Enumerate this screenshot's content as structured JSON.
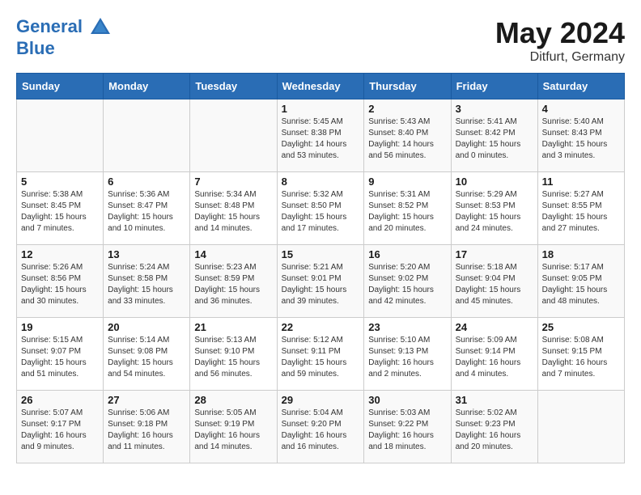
{
  "header": {
    "logo_line1": "General",
    "logo_line2": "Blue",
    "month": "May 2024",
    "location": "Ditfurt, Germany"
  },
  "weekdays": [
    "Sunday",
    "Monday",
    "Tuesday",
    "Wednesday",
    "Thursday",
    "Friday",
    "Saturday"
  ],
  "weeks": [
    [
      {
        "day": "",
        "info": ""
      },
      {
        "day": "",
        "info": ""
      },
      {
        "day": "",
        "info": ""
      },
      {
        "day": "1",
        "info": "Sunrise: 5:45 AM\nSunset: 8:38 PM\nDaylight: 14 hours\nand 53 minutes."
      },
      {
        "day": "2",
        "info": "Sunrise: 5:43 AM\nSunset: 8:40 PM\nDaylight: 14 hours\nand 56 minutes."
      },
      {
        "day": "3",
        "info": "Sunrise: 5:41 AM\nSunset: 8:42 PM\nDaylight: 15 hours\nand 0 minutes."
      },
      {
        "day": "4",
        "info": "Sunrise: 5:40 AM\nSunset: 8:43 PM\nDaylight: 15 hours\nand 3 minutes."
      }
    ],
    [
      {
        "day": "5",
        "info": "Sunrise: 5:38 AM\nSunset: 8:45 PM\nDaylight: 15 hours\nand 7 minutes."
      },
      {
        "day": "6",
        "info": "Sunrise: 5:36 AM\nSunset: 8:47 PM\nDaylight: 15 hours\nand 10 minutes."
      },
      {
        "day": "7",
        "info": "Sunrise: 5:34 AM\nSunset: 8:48 PM\nDaylight: 15 hours\nand 14 minutes."
      },
      {
        "day": "8",
        "info": "Sunrise: 5:32 AM\nSunset: 8:50 PM\nDaylight: 15 hours\nand 17 minutes."
      },
      {
        "day": "9",
        "info": "Sunrise: 5:31 AM\nSunset: 8:52 PM\nDaylight: 15 hours\nand 20 minutes."
      },
      {
        "day": "10",
        "info": "Sunrise: 5:29 AM\nSunset: 8:53 PM\nDaylight: 15 hours\nand 24 minutes."
      },
      {
        "day": "11",
        "info": "Sunrise: 5:27 AM\nSunset: 8:55 PM\nDaylight: 15 hours\nand 27 minutes."
      }
    ],
    [
      {
        "day": "12",
        "info": "Sunrise: 5:26 AM\nSunset: 8:56 PM\nDaylight: 15 hours\nand 30 minutes."
      },
      {
        "day": "13",
        "info": "Sunrise: 5:24 AM\nSunset: 8:58 PM\nDaylight: 15 hours\nand 33 minutes."
      },
      {
        "day": "14",
        "info": "Sunrise: 5:23 AM\nSunset: 8:59 PM\nDaylight: 15 hours\nand 36 minutes."
      },
      {
        "day": "15",
        "info": "Sunrise: 5:21 AM\nSunset: 9:01 PM\nDaylight: 15 hours\nand 39 minutes."
      },
      {
        "day": "16",
        "info": "Sunrise: 5:20 AM\nSunset: 9:02 PM\nDaylight: 15 hours\nand 42 minutes."
      },
      {
        "day": "17",
        "info": "Sunrise: 5:18 AM\nSunset: 9:04 PM\nDaylight: 15 hours\nand 45 minutes."
      },
      {
        "day": "18",
        "info": "Sunrise: 5:17 AM\nSunset: 9:05 PM\nDaylight: 15 hours\nand 48 minutes."
      }
    ],
    [
      {
        "day": "19",
        "info": "Sunrise: 5:15 AM\nSunset: 9:07 PM\nDaylight: 15 hours\nand 51 minutes."
      },
      {
        "day": "20",
        "info": "Sunrise: 5:14 AM\nSunset: 9:08 PM\nDaylight: 15 hours\nand 54 minutes."
      },
      {
        "day": "21",
        "info": "Sunrise: 5:13 AM\nSunset: 9:10 PM\nDaylight: 15 hours\nand 56 minutes."
      },
      {
        "day": "22",
        "info": "Sunrise: 5:12 AM\nSunset: 9:11 PM\nDaylight: 15 hours\nand 59 minutes."
      },
      {
        "day": "23",
        "info": "Sunrise: 5:10 AM\nSunset: 9:13 PM\nDaylight: 16 hours\nand 2 minutes."
      },
      {
        "day": "24",
        "info": "Sunrise: 5:09 AM\nSunset: 9:14 PM\nDaylight: 16 hours\nand 4 minutes."
      },
      {
        "day": "25",
        "info": "Sunrise: 5:08 AM\nSunset: 9:15 PM\nDaylight: 16 hours\nand 7 minutes."
      }
    ],
    [
      {
        "day": "26",
        "info": "Sunrise: 5:07 AM\nSunset: 9:17 PM\nDaylight: 16 hours\nand 9 minutes."
      },
      {
        "day": "27",
        "info": "Sunrise: 5:06 AM\nSunset: 9:18 PM\nDaylight: 16 hours\nand 11 minutes."
      },
      {
        "day": "28",
        "info": "Sunrise: 5:05 AM\nSunset: 9:19 PM\nDaylight: 16 hours\nand 14 minutes."
      },
      {
        "day": "29",
        "info": "Sunrise: 5:04 AM\nSunset: 9:20 PM\nDaylight: 16 hours\nand 16 minutes."
      },
      {
        "day": "30",
        "info": "Sunrise: 5:03 AM\nSunset: 9:22 PM\nDaylight: 16 hours\nand 18 minutes."
      },
      {
        "day": "31",
        "info": "Sunrise: 5:02 AM\nSunset: 9:23 PM\nDaylight: 16 hours\nand 20 minutes."
      },
      {
        "day": "",
        "info": ""
      }
    ]
  ]
}
